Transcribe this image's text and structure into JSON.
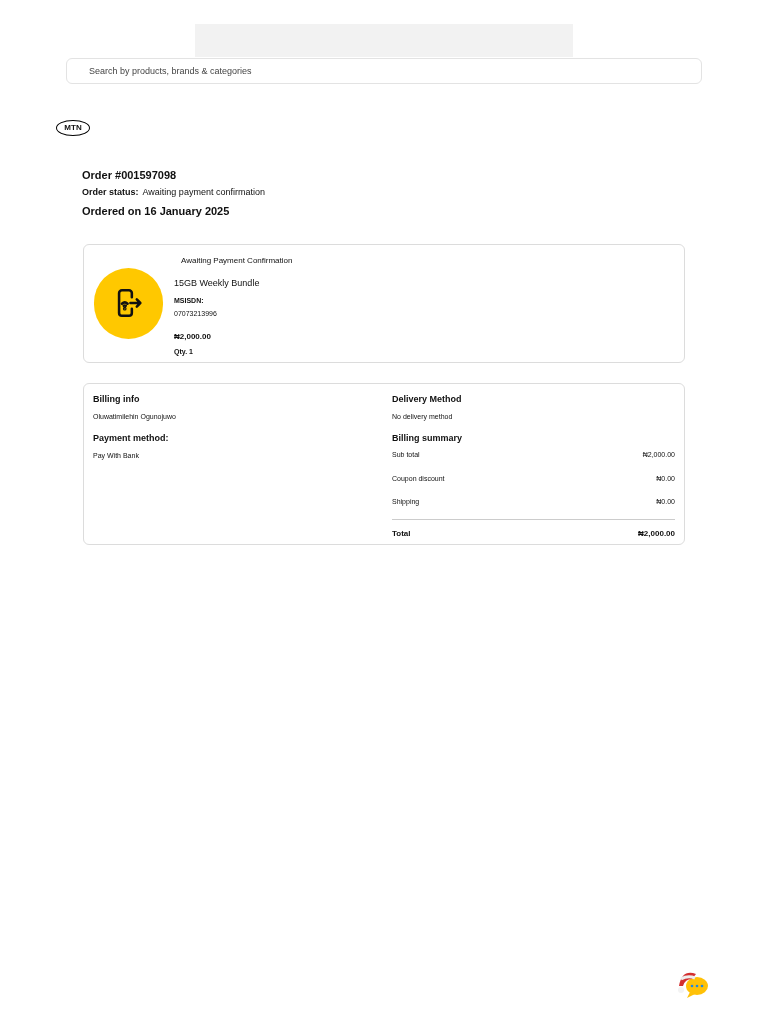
{
  "search": {
    "placeholder": "Search by products, brands & categories"
  },
  "logo": {
    "text": "MTN"
  },
  "order": {
    "number": "Order #001597098",
    "status_label": "Order status:",
    "status": "Awaiting payment confirmation",
    "date": "Ordered on 16 January 2025"
  },
  "item": {
    "status": "Awaiting Payment Confirmation",
    "name": "15GB Weekly Bundle",
    "msisdn_label": "MSISDN:",
    "msisdn": "07073213996",
    "price": "₦2,000.00",
    "qty": "Qty. 1"
  },
  "billing_info": {
    "title": "Billing info",
    "name": "Oluwatimilehin Ogunojuwo",
    "payment_title": "Payment method:",
    "payment": "Pay With Bank"
  },
  "delivery": {
    "title": "Delivery Method",
    "value": "No delivery method"
  },
  "summary": {
    "title": "Billing summary",
    "rows": [
      {
        "label": "Sub total",
        "value": "₦2,000.00"
      },
      {
        "label": "Coupon discount",
        "value": "₦0.00"
      },
      {
        "label": "Shipping",
        "value": "₦0.00"
      }
    ],
    "total": {
      "label": "Total",
      "value": "₦2,000.00"
    }
  }
}
